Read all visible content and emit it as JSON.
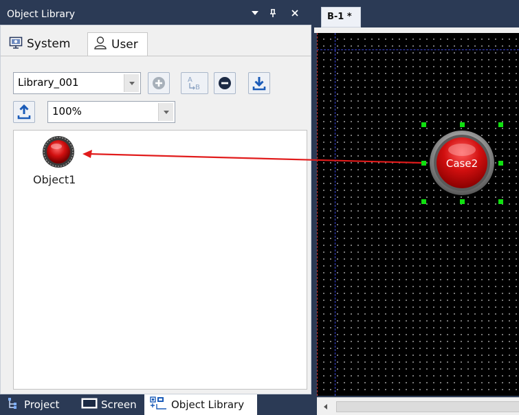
{
  "panel": {
    "title": "Object Library",
    "title_icons": [
      "dropdown-icon",
      "pin-icon",
      "close-icon"
    ],
    "tabs": [
      {
        "label": "System",
        "icon": "monitor-icon",
        "active": false
      },
      {
        "label": "User",
        "icon": "user-icon",
        "active": true
      }
    ],
    "library_select": {
      "value": "Library_001"
    },
    "toolbar": [
      "add-icon",
      "rename-icon",
      "remove-icon",
      "export-icon",
      "import-icon"
    ],
    "zoom_select": {
      "value": "100%"
    },
    "objects": [
      {
        "label": "Object1",
        "icon": "red-lamp-icon"
      }
    ]
  },
  "bottom_tabs": [
    {
      "label": "Project",
      "icon": "project-tree-icon",
      "active": false
    },
    {
      "label": "Screen",
      "icon": "screen-icon",
      "active": false
    },
    {
      "label": "Object Library",
      "icon": "object-library-icon",
      "active": true
    }
  ],
  "document": {
    "tab_label": "B-1 *",
    "object": {
      "label": "Case2",
      "color": "#d10f0f"
    },
    "annotation_color": "#e11b1b",
    "handle_color": "#10e010"
  }
}
